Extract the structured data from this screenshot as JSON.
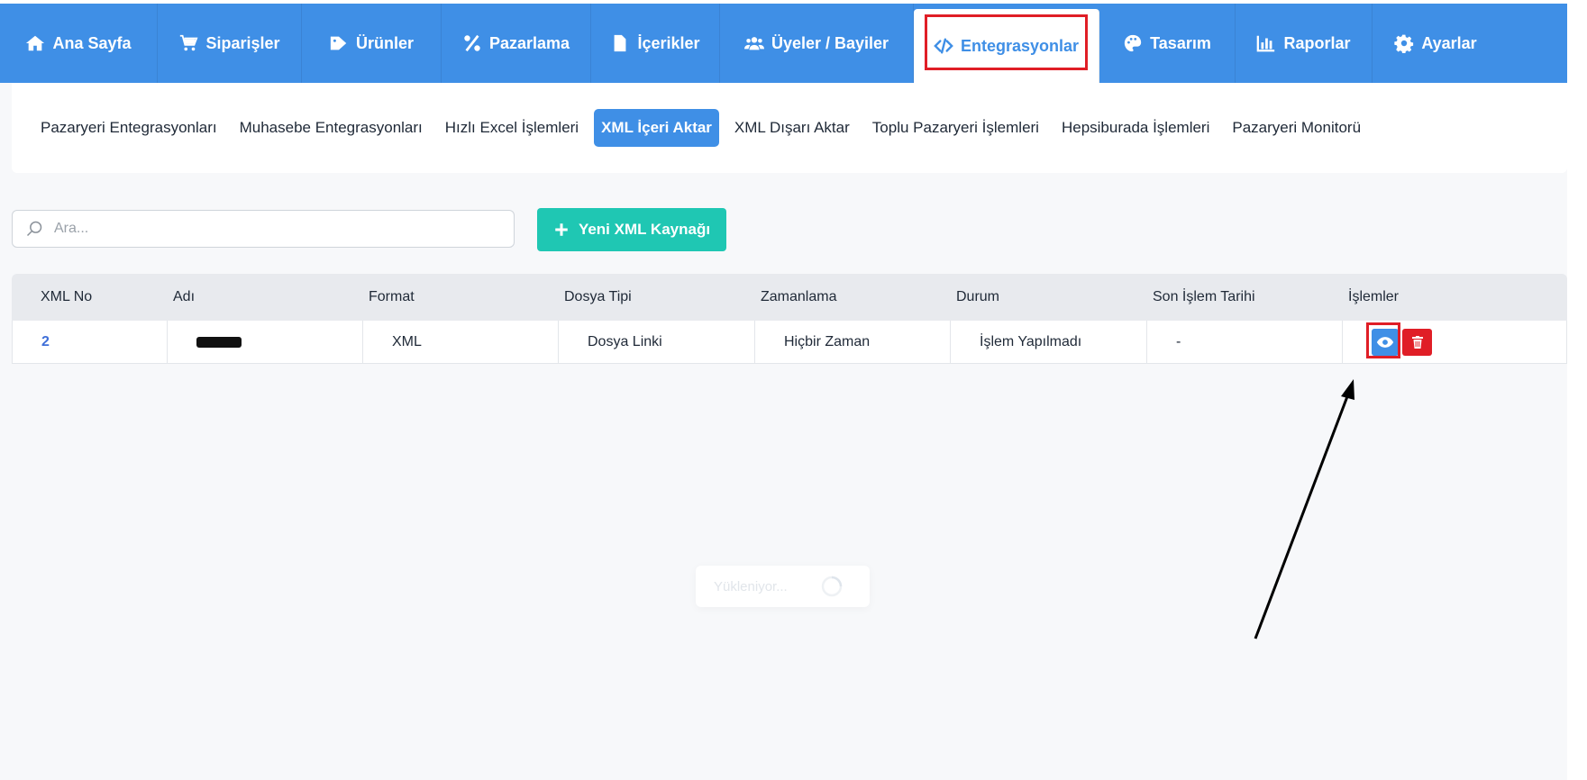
{
  "nav": {
    "items": [
      {
        "label": "Ana Sayfa",
        "icon": "home-icon"
      },
      {
        "label": "Siparişler",
        "icon": "cart-icon"
      },
      {
        "label": "Ürünler",
        "icon": "tags-icon"
      },
      {
        "label": "Pazarlama",
        "icon": "percent-icon"
      },
      {
        "label": "İçerikler",
        "icon": "file-icon"
      },
      {
        "label": "Üyeler / Bayiler",
        "icon": "users-icon"
      },
      {
        "label": "Entegrasyonlar",
        "icon": "code-icon",
        "active": true
      },
      {
        "label": "Tasarım",
        "icon": "palette-icon"
      },
      {
        "label": "Raporlar",
        "icon": "chart-icon"
      },
      {
        "label": "Ayarlar",
        "icon": "gear-icon"
      }
    ]
  },
  "subnav": {
    "items": [
      {
        "label": "Pazaryeri Entegrasyonları"
      },
      {
        "label": "Muhasebe Entegrasyonları"
      },
      {
        "label": "Hızlı Excel İşlemleri"
      },
      {
        "label": "XML İçeri Aktar",
        "active": true
      },
      {
        "label": "XML Dışarı Aktar"
      },
      {
        "label": "Toplu Pazaryeri İşlemleri"
      },
      {
        "label": "Hepsiburada İşlemleri"
      },
      {
        "label": "Pazaryeri Monitorü"
      }
    ]
  },
  "search": {
    "placeholder": "Ara..."
  },
  "add_button": {
    "label": "Yeni XML Kaynağı"
  },
  "table": {
    "headers": [
      "XML No",
      "Adı",
      "Format",
      "Dosya Tipi",
      "Zamanlama",
      "Durum",
      "Son İşlem Tarihi",
      "İşlemler"
    ],
    "rows": [
      {
        "no": "2",
        "name": "",
        "format": "XML",
        "file_type": "Dosya Linki",
        "schedule": "Hiçbir Zaman",
        "status": "İşlem Yapılmadı",
        "last_date": "-"
      }
    ]
  },
  "loading": {
    "label": "Yükleniyor..."
  },
  "colors": {
    "primary": "#3f8fe6",
    "accent": "#1fc7b3",
    "danger": "#e01e26",
    "highlight": "#e01e26"
  }
}
